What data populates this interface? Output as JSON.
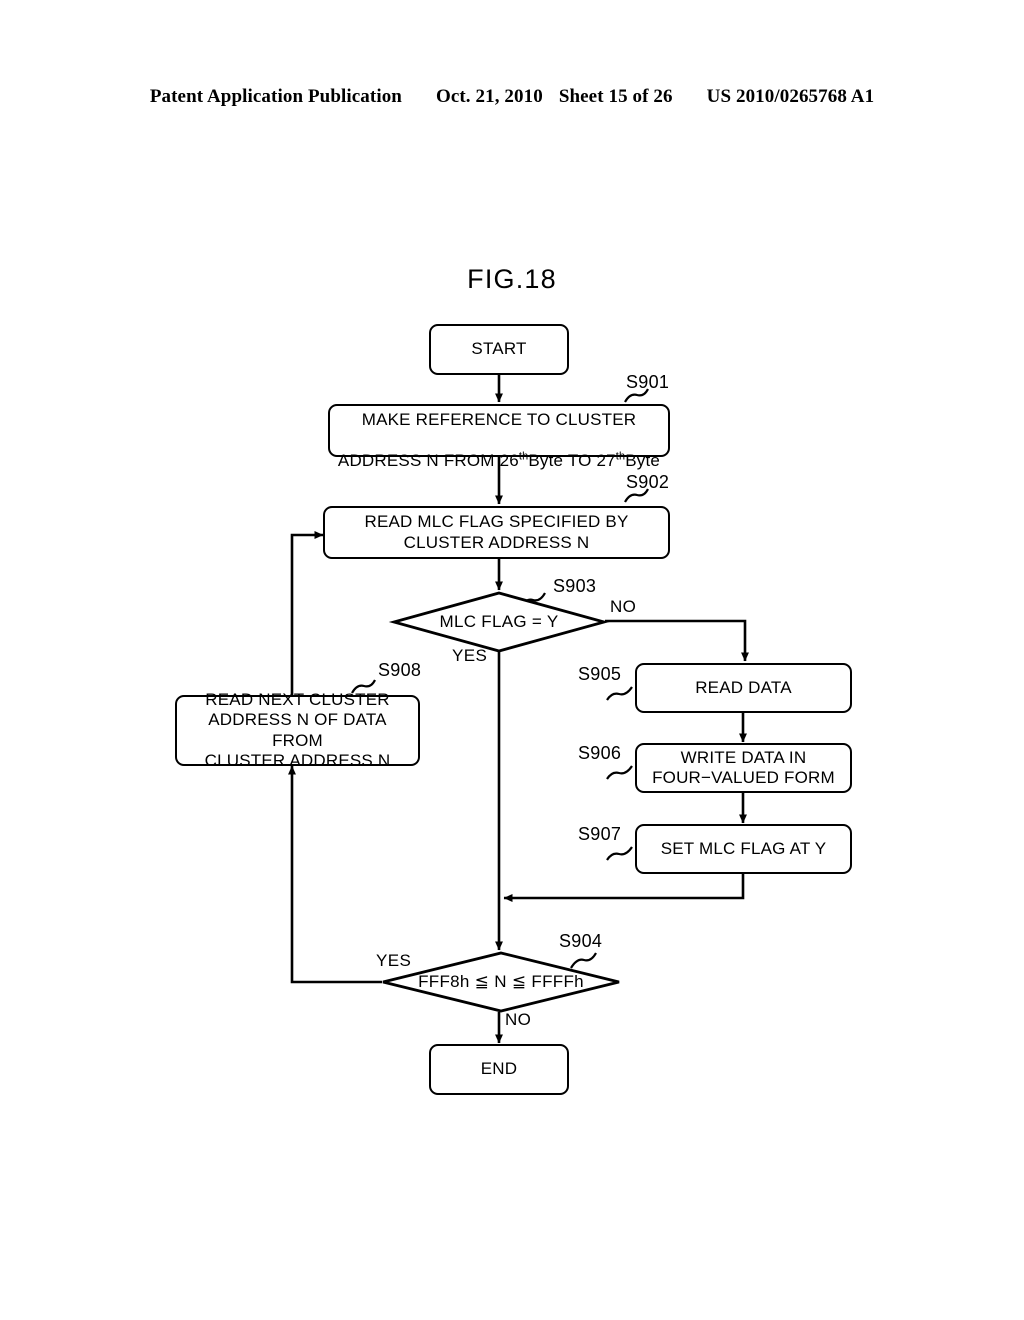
{
  "header": {
    "publication": "Patent Application Publication",
    "date": "Oct. 21, 2010",
    "sheet": "Sheet 15 of 26",
    "patent_number": "US 2010/0265768 A1"
  },
  "figure": {
    "title": "FIG.18"
  },
  "flowchart": {
    "nodes": {
      "start": {
        "label": "START"
      },
      "s901": {
        "ref": "S901",
        "line1": "MAKE REFERENCE TO CLUSTER",
        "line2_a": "ADDRESS N FROM 26",
        "sup1": "th",
        "line2_b": "Byte TO 27",
        "sup2": "th",
        "line2_c": "Byte"
      },
      "s902": {
        "ref": "S902",
        "label": "READ MLC FLAG SPECIFIED BY\nCLUSTER ADDRESS N"
      },
      "s903": {
        "ref": "S903",
        "label": "MLC FLAG  = Y"
      },
      "s904": {
        "ref": "S904",
        "label": "FFF8h ≦ N ≦ FFFFh"
      },
      "s905": {
        "ref": "S905",
        "label": "READ DATA"
      },
      "s906": {
        "ref": "S906",
        "label": "WRITE DATA IN\nFOUR−VALUED FORM"
      },
      "s907": {
        "ref": "S907",
        "label": "SET MLC FLAG AT Y"
      },
      "s908": {
        "ref": "S908",
        "label": "READ NEXT CLUSTER\nADDRESS N OF DATA FROM\nCLUSTER ADDRESS N"
      },
      "end": {
        "label": "END"
      }
    },
    "edge_labels": {
      "s903_no": "NO",
      "s903_yes": "YES",
      "s904_yes": "YES",
      "s904_no": "NO"
    }
  },
  "colors": {
    "ink": "#000000",
    "paper": "#ffffff"
  }
}
